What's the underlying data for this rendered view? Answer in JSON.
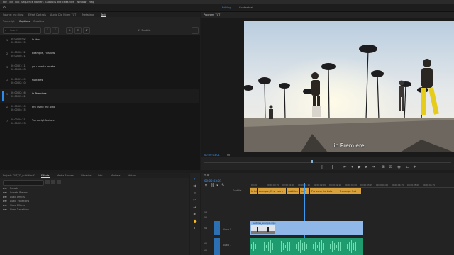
{
  "menu": [
    "File",
    "Edit",
    "Clip",
    "Sequence",
    "Markers",
    "Graphics and Titles",
    "View",
    "Window",
    "Help"
  ],
  "workspaces": {
    "editing": "Editing",
    "other": "Contextual"
  },
  "top_tabs": [
    "Source: (no clips)",
    "Effect Controls",
    "Audio Clip Mixer: TUT",
    "Metadata",
    "Text"
  ],
  "text_panel": {
    "subtabs": [
      "Transcript",
      "Captions",
      "Graphics"
    ],
    "active_subtab": "Captions",
    "search_placeholder": "Search",
    "subtitle_count": "17 Subtitle",
    "captions": [
      {
        "num": "1",
        "in": "00:00:00:02",
        "out": "00:00:00:15",
        "text": "In this"
      },
      {
        "num": "2",
        "in": "00:00:00:12",
        "out": "00:00:00:21",
        "text": "example, I'll show"
      },
      {
        "num": "3",
        "in": "00:00:01:11",
        "out": "00:00:02:03",
        "text": "you how to create"
      },
      {
        "num": "4",
        "in": "00:00:01:09",
        "out": "00:00:02:10",
        "text": "subtitles"
      },
      {
        "num": "5",
        "in": "00:00:02:16",
        "out": "00:00:03:01",
        "text": "in Premiere"
      },
      {
        "num": "6",
        "in": "00:00:03:10",
        "out": "00:00:04:15",
        "text": "Pro using the Auto"
      },
      {
        "num": "7",
        "in": "00:00:04:21",
        "out": "00:00:05:23",
        "text": "Transcript feature."
      }
    ]
  },
  "program": {
    "title": "Program: TUT",
    "caption_overlay": "in Premiere",
    "timecode": "00:00:03:01",
    "fit": "Fit"
  },
  "project": {
    "tabs": [
      "Project: TUT_??_subtitles t2",
      "Effects",
      "Media Browser",
      "Libraries",
      "Info",
      "Markers",
      "History"
    ],
    "active_tab": "Effects",
    "folders": [
      "Presets",
      "Lumetri Presets",
      "Audio Effects",
      "Audio Transitions",
      "Video Effects",
      "Video Transitions"
    ]
  },
  "timeline": {
    "tab": "TUT",
    "timecode": "00:00:03:01",
    "subtitle_track": "Subtitle",
    "clips": [
      "In this",
      "example, I'll sh",
      "you h",
      "subtitles",
      "in P",
      "Pro using the Auto",
      "Transcript feat"
    ],
    "ruler": [
      "00:00",
      "00:00:00:15",
      "00:00:01:00",
      "00:00:01:15",
      "00:00:02:00",
      "00:00:02:15",
      "00:00:03:00",
      "00:00:03:15",
      "00:00:04:00",
      "00:00:04:15",
      "00:00:05:00",
      "00:00:05:15"
    ],
    "video_track": "Video 1",
    "audio_track": "Audio 1",
    "video_clip_label": "subtitles_example.mp4",
    "tracks": [
      "V3",
      "V2",
      "V1",
      "A1",
      "A2"
    ]
  },
  "colors": {
    "accent": "#2d8ceb",
    "caption_clip": "#d9a13b",
    "video_clip": "#8fb8e8",
    "audio_clip": "#1e9b6f"
  }
}
